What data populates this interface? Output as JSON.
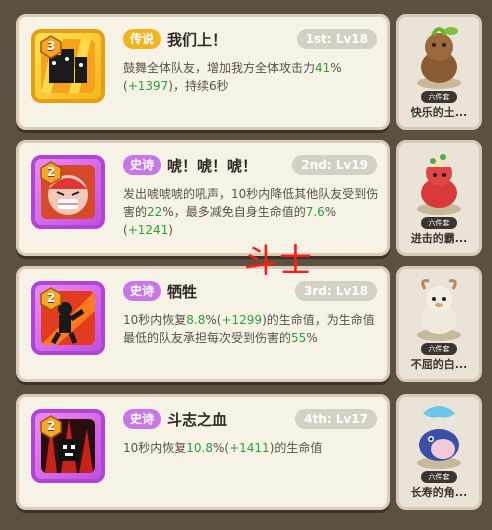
{
  "skills": [
    {
      "rank": "3",
      "rarity": "传说",
      "title": "我们上！",
      "level": "1st: Lv18",
      "desc_before": "鼓舞全体队友，增加我方全体攻击力",
      "desc_value": "41",
      "desc_mid": "%(",
      "desc_value2": "+1397",
      "desc_after": ")，持续6秒",
      "creature_tag": "六件套",
      "creature_name": "快乐的土..."
    },
    {
      "rank": "2",
      "rarity": "史诗",
      "title": "唬！唬！唬！",
      "level": "2nd: Lv19",
      "desc_before": "发出唬唬唬的吼声，10秒内降低其他队友受到伤害的",
      "desc_value": "22",
      "desc_mid": "%，最多减免自身生命值的",
      "desc_value2": "7.6",
      "desc_mid2": "%(",
      "desc_value3": "+1241",
      "desc_after": ")",
      "creature_tag": "六件套",
      "creature_name": "进击的霸..."
    },
    {
      "rank": "2",
      "rarity": "史诗",
      "title": "牺牲",
      "level": "3rd: Lv18",
      "desc_before": "10秒内恢复",
      "desc_value": "8.8",
      "desc_mid": "%(",
      "desc_value2": "+1299",
      "desc_mid2": ")的生命值，为生命值最低的队友承担每次受到伤害的",
      "desc_value3": "55",
      "desc_after": "%",
      "creature_tag": "六件套",
      "creature_name": "不屈的白..."
    },
    {
      "rank": "2",
      "rarity": "史诗",
      "title": "斗志之血",
      "level": "4th: Lv17",
      "desc_before": "10秒内恢复",
      "desc_value": "10.8",
      "desc_mid": "%(",
      "desc_value2": "+1411",
      "desc_after": ")的生命值",
      "creature_tag": "六件套",
      "creature_name": "长寿的角..."
    }
  ],
  "overlay_text": "斗士",
  "colors": {
    "legend": "#f2b320",
    "epic": "#c777e6",
    "value_green": "#27a13a",
    "overlay_red": "#ff1a1a"
  }
}
